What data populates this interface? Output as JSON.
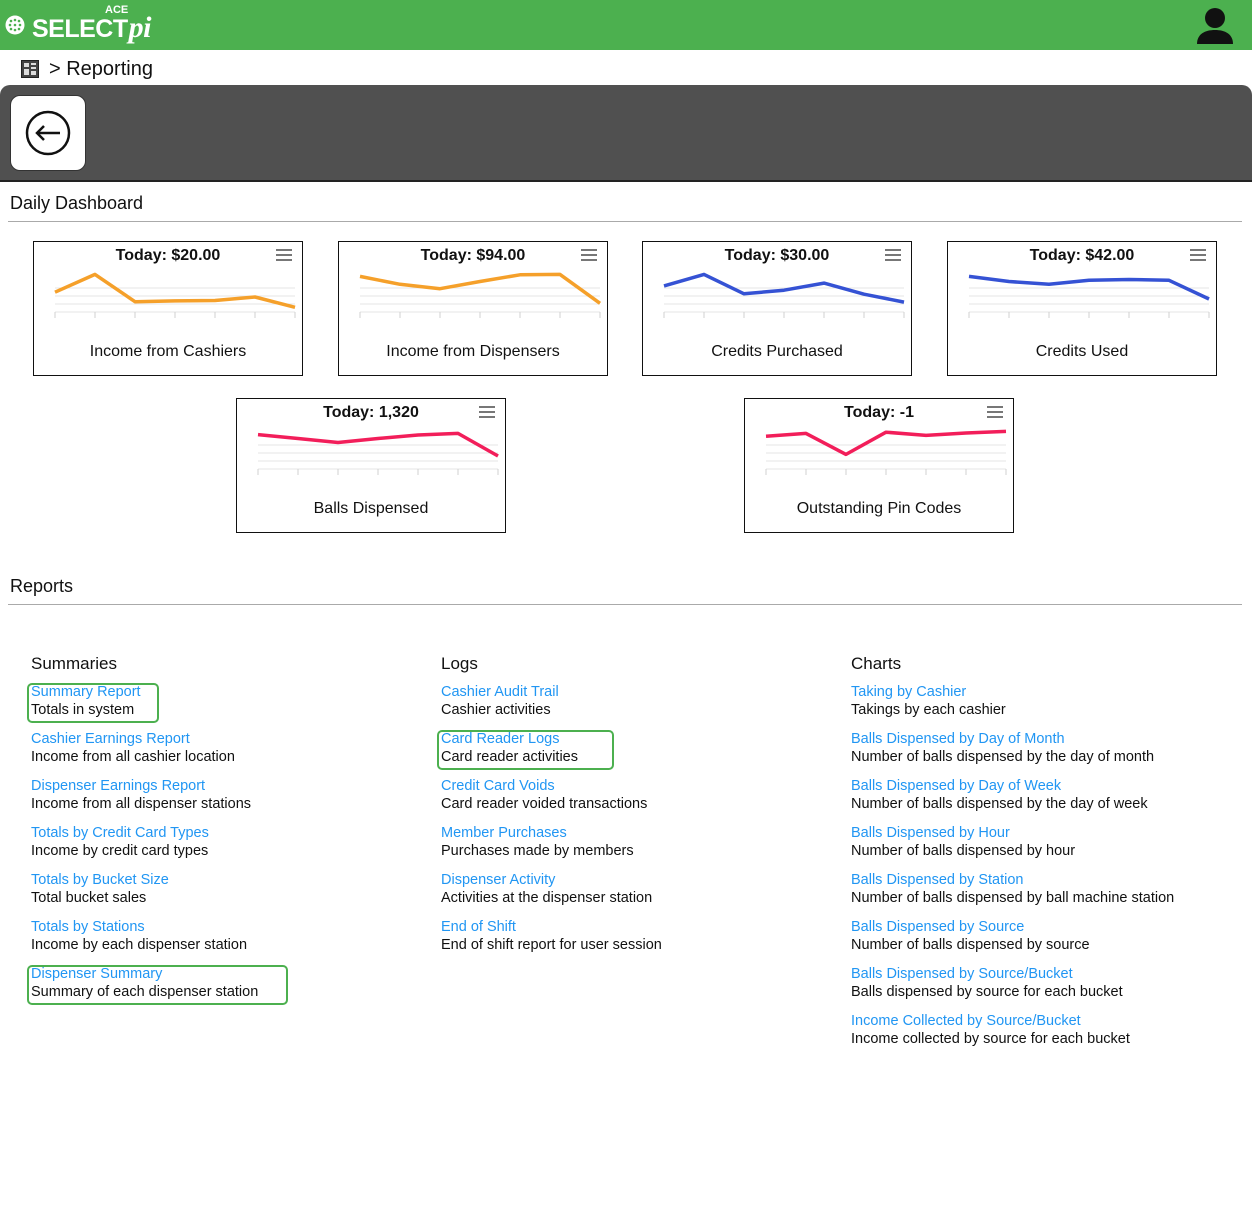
{
  "app": {
    "logo_text": "SELECT",
    "logo_suffix": "pi",
    "logo_badge": "ACE",
    "brand_color": "#4cb04f"
  },
  "breadcrumb": {
    "text": "> Reporting",
    "icon": "dashboard-icon"
  },
  "toolbar": {
    "back_icon": "arrow-left-icon"
  },
  "dashboard": {
    "title": "Daily Dashboard",
    "widgets": [
      {
        "today": "Today: $20.00",
        "label": "Income from Cashiers",
        "color": "#f5a02a",
        "values": [
          0.55,
          1.0,
          0.31,
          0.33,
          0.34,
          0.43,
          0.17
        ]
      },
      {
        "today": "Today: $94.00",
        "label": "Income from Dispensers",
        "color": "#f5a02a",
        "values": [
          0.95,
          0.75,
          0.64,
          0.82,
          0.99,
          1.0,
          0.27
        ]
      },
      {
        "today": "Today: $30.00",
        "label": "Credits Purchased",
        "color": "#3552d4",
        "values": [
          0.71,
          1.0,
          0.51,
          0.6,
          0.78,
          0.5,
          0.3
        ]
      },
      {
        "today": "Today: $42.00",
        "label": "Credits Used",
        "color": "#3552d4",
        "values": [
          0.95,
          0.82,
          0.75,
          0.85,
          0.87,
          0.85,
          0.38
        ]
      },
      {
        "today": "Today: 1,320",
        "label": "Balls Dispensed",
        "color": "#f21e5a",
        "values": [
          0.92,
          0.82,
          0.72,
          0.82,
          0.91,
          0.95,
          0.38
        ]
      },
      {
        "today": "Today: -1",
        "label": "Outstanding Pin Codes",
        "color": "#f21e5a",
        "values": [
          0.88,
          0.95,
          0.42,
          0.98,
          0.9,
          0.96,
          1.0
        ]
      }
    ]
  },
  "reports": {
    "title": "Reports",
    "columns": [
      {
        "heading": "Summaries",
        "items": [
          {
            "link": "Summary Report",
            "desc": "Totals in system",
            "highlight": true
          },
          {
            "link": "Cashier Earnings Report",
            "desc": "Income from all cashier location"
          },
          {
            "link": "Dispenser Earnings Report",
            "desc": "Income from all dispenser stations"
          },
          {
            "link": "Totals by Credit Card Types",
            "desc": "Income by credit card types"
          },
          {
            "link": "Totals by Bucket Size",
            "desc": "Total bucket sales"
          },
          {
            "link": "Totals by Stations",
            "desc": "Income by each dispenser station"
          },
          {
            "link": "Dispenser Summary",
            "desc": "Summary of each dispenser station",
            "highlight": true
          }
        ]
      },
      {
        "heading": "Logs",
        "items": [
          {
            "link": "Cashier Audit Trail",
            "desc": "Cashier activities"
          },
          {
            "link": "Card Reader Logs",
            "desc": "Card reader activities",
            "highlight": true
          },
          {
            "link": "Credit Card Voids",
            "desc": "Card reader voided transactions"
          },
          {
            "link": "Member Purchases",
            "desc": "Purchases made by members"
          },
          {
            "link": "Dispenser Activity",
            "desc": "Activities at the dispenser station"
          },
          {
            "link": "End of Shift",
            "desc": "End of shift report for user session"
          }
        ]
      },
      {
        "heading": "Charts",
        "items": [
          {
            "link": "Taking by Cashier",
            "desc": "Takings by each cashier"
          },
          {
            "link": "Balls Dispensed by Day of Month",
            "desc": "Number of balls dispensed by the day of month"
          },
          {
            "link": "Balls Dispensed by Day of Week",
            "desc": "Number of balls dispensed by the day of week"
          },
          {
            "link": "Balls Dispensed by Hour",
            "desc": "Number of balls dispensed by hour"
          },
          {
            "link": "Balls Dispensed by Station",
            "desc": "Number of balls dispensed by ball machine station"
          },
          {
            "link": "Balls Dispensed by Source",
            "desc": "Number of balls dispensed by source"
          },
          {
            "link": "Balls Dispensed by Source/Bucket",
            "desc": "Balls dispensed by source for each bucket"
          },
          {
            "link": "Income Collected by Source/Bucket",
            "desc": "Income collected by source for each bucket"
          }
        ]
      }
    ]
  }
}
